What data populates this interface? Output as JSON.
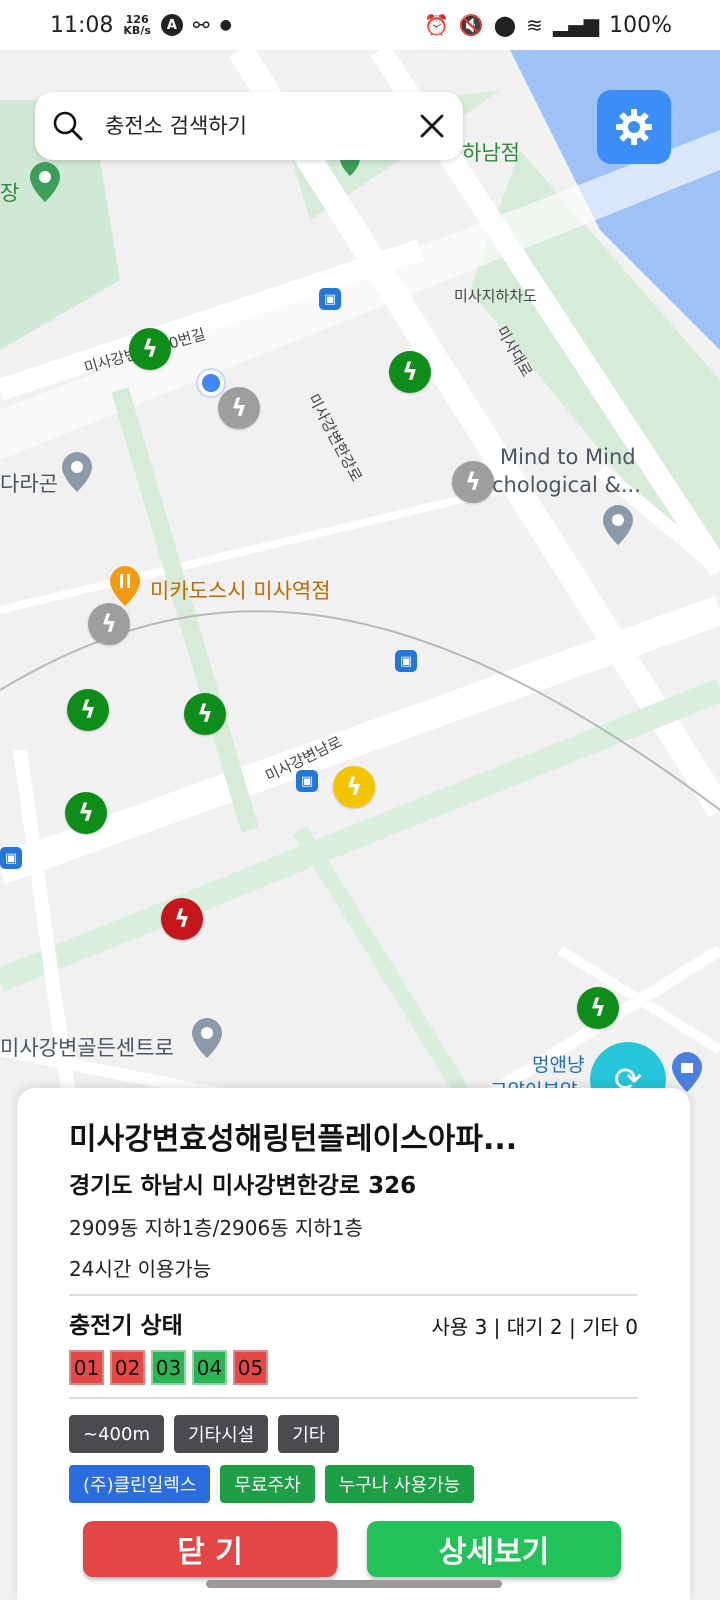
{
  "status_bar": {
    "time": "11:08",
    "speed_value": "126",
    "speed_unit": "KB/s",
    "battery": "100%"
  },
  "search": {
    "placeholder": "충전소 검색하기"
  },
  "map": {
    "labels": {
      "road_110": "미사강변로110번길",
      "road_hangang": "미사강변한강로",
      "road_namro": "미사강변남로",
      "road_daero": "미사대로",
      "underpass": "미사지하차도",
      "hanam": "하남점",
      "restaurant": "미카도스시 미사역점",
      "mind_line1": "Mind to Mind",
      "mind_line2": "chological &...",
      "golden": "미사강변골든센트로",
      "darago": "다라곤",
      "jang": "장",
      "meong_line1": "멍앤냥",
      "meong_line2": "고양이분양"
    },
    "colors": {
      "available": "#0f8d1b",
      "offline": "#9e9e9e",
      "warning": "#f5c400",
      "error": "#c4161c",
      "water": "#9fc2f6",
      "park": "#cfe9d6"
    }
  },
  "station": {
    "name": "미사강변효성해링턴플레이스아파...",
    "address": "경기도 하남시 미사강변한강로 326",
    "detail": "2909동 지하1층/2906동 지하1층",
    "hours": "24시간 이용가능",
    "status_title": "충전기 상태",
    "status_summary": "사용 3 | 대기 2 | 기타 0",
    "chargers": [
      {
        "id": "01",
        "state": "busy"
      },
      {
        "id": "02",
        "state": "busy"
      },
      {
        "id": "03",
        "state": "free"
      },
      {
        "id": "04",
        "state": "free"
      },
      {
        "id": "05",
        "state": "busy"
      }
    ],
    "tags_row1": [
      "~400m",
      "기타시설",
      "기타"
    ],
    "tags_row2": [
      "(주)클린일렉스",
      "무료주차",
      "누구나 사용가능"
    ],
    "close_label": "닫 기",
    "detail_label": "상세보기"
  }
}
